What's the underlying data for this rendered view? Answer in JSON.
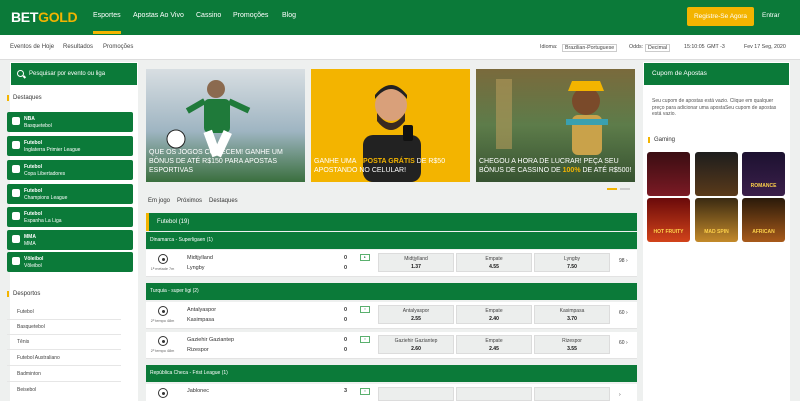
{
  "header": {
    "logo_bet": "BET",
    "logo_gold": "GOLD",
    "nav": [
      "Esportes",
      "Apostas Ao Vivo",
      "Cassino",
      "Promoções",
      "Blog"
    ],
    "register_label": "Registre-Se Agora",
    "enter_label": "Entrar"
  },
  "subbar": {
    "links": [
      "Eventos de Hoje",
      "Resultados",
      "Promoções"
    ],
    "language_label": "Idioma:",
    "language_value": "Brazilian-Portuguese",
    "odds_label": "Odds:",
    "odds_value": "Decimal",
    "time": "15:10:05",
    "timezone": "GMT -3",
    "date": "Fev 17 Seg, 2020"
  },
  "sidebar": {
    "search_label": "Pesquisar por evento ou liga",
    "highlights_title": "Destaques",
    "highlights": [
      {
        "sport": "NBA",
        "league": "Basquetebol"
      },
      {
        "sport": "Futebol",
        "league": "Inglaterra Primier League"
      },
      {
        "sport": "Futebol",
        "league": "Copa Libertadores"
      },
      {
        "sport": "Futebol",
        "league": "Champions League"
      },
      {
        "sport": "Futebol",
        "league": "Espanha La Liga"
      },
      {
        "sport": "MMA",
        "league": "MMA"
      },
      {
        "sport": "Vôleibol",
        "league": "Vôleibol"
      }
    ],
    "sports_title": "Desportos",
    "sports": [
      "Futebol",
      "Basquetebol",
      "Tênis",
      "Futebol Australiano",
      "Badminton",
      "Beisebol"
    ]
  },
  "banners": [
    {
      "text_pre": "QUE OS JOGOS COMECEM! GANHE UM BÔNUS DE ATÉ R$150 PARA APOSTAS ESPORTIVAS",
      "highlight": "",
      "text_post": ""
    },
    {
      "text_pre": "GANHE UMA ",
      "highlight": "APOSTA GRÁTIS",
      "text_post": " DE R$50 APOSTANDO NO CELULAR!"
    },
    {
      "text_pre": "CHEGOU A HORA DE LUCRAR! PEÇA SEU BÔNUS DE CASSINO DE ",
      "highlight": "100%",
      "text_post": " DE ATÉ R$500!"
    }
  ],
  "tabs": [
    "Em jogo",
    "Próximos",
    "Destaques"
  ],
  "section": {
    "title": "Futebol",
    "count": "(19)"
  },
  "leagues": [
    {
      "name": "Dinamarca - Superligaen (1)"
    },
    {
      "name": "Turquia - super ligi (2)"
    },
    {
      "name": "República Checa - Frist League (1)"
    }
  ],
  "matches": [
    {
      "time": "1ª metade 7m",
      "home": "Midtjylland",
      "away": "Lyngby",
      "home_score": "0",
      "away_score": "0",
      "odds": [
        {
          "name": "Midtjylland",
          "value": "1.37"
        },
        {
          "name": "Empate",
          "value": "4.55"
        },
        {
          "name": "Lyngby",
          "value": "7.50"
        }
      ],
      "more": "98"
    },
    {
      "time": "2º tempo 48m",
      "home": "Antalyaspor",
      "away": "Kasimpasa",
      "home_score": "0",
      "away_score": "0",
      "odds": [
        {
          "name": "Antalyaspor",
          "value": "2.55"
        },
        {
          "name": "Empate",
          "value": "2.40"
        },
        {
          "name": "Kasimpasa",
          "value": "3.70"
        }
      ],
      "more": "60"
    },
    {
      "time": "2º tempo 48m",
      "home": "Gaziehir Gaziantep",
      "away": "Rizespor",
      "home_score": "0",
      "away_score": "0",
      "odds": [
        {
          "name": "Gaziehir Gaziantep",
          "value": "2.60"
        },
        {
          "name": "Empate",
          "value": "2.45"
        },
        {
          "name": "Rizespor",
          "value": "3.55"
        }
      ],
      "more": "60"
    },
    {
      "time": "",
      "home": "Jablonec",
      "away": "",
      "home_score": "3",
      "away_score": "",
      "odds": [],
      "more": ""
    }
  ],
  "coupon": {
    "title": "Cupom de Apostas",
    "description": "Seu cupom de apostas está vazio. Clique em qualquer preço para adicionar uma apostaSeu cupom de apostas está vazio."
  },
  "gaming": {
    "title": "Gaming",
    "games": [
      "",
      "",
      "ROMANCE",
      "HOT FRUITY",
      "MAD SPIN",
      "AFRICAN"
    ]
  }
}
